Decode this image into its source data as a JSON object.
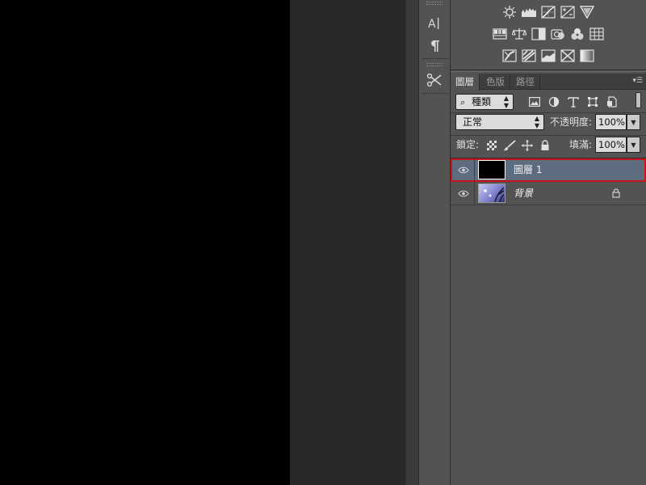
{
  "tool_strip": {
    "tools": [
      {
        "icon": "character-panel-icon",
        "glyph": "A|"
      },
      {
        "icon": "paragraph-panel-icon",
        "glyph": "¶"
      },
      {
        "icon": "tool-presets-icon",
        "glyph": "✂"
      }
    ]
  },
  "adjustments": {
    "row1": [
      "brightness-contrast-icon",
      "levels-icon",
      "curves-icon",
      "exposure-icon",
      "vibrance-icon"
    ],
    "row2": [
      "hue-saturation-icon",
      "color-balance-icon",
      "black-white-icon",
      "photo-filter-icon",
      "channel-mixer-icon",
      "color-lookup-icon"
    ],
    "row3": [
      "invert-icon",
      "posterize-icon",
      "threshold-icon",
      "selective-color-icon",
      "gradient-map-icon"
    ]
  },
  "layers_panel": {
    "tabs": [
      {
        "label": "圖層",
        "active": true
      },
      {
        "label": "色版",
        "active": false
      },
      {
        "label": "路徑",
        "active": false
      }
    ],
    "menu_glyph": "▾☰",
    "filter": {
      "search_glyph": "⌕",
      "kind_label": "種類",
      "filter_icons": [
        "image-filter-icon",
        "adjustment-filter-icon",
        "type-filter-icon",
        "shape-filter-icon",
        "smart-object-filter-icon"
      ]
    },
    "blend": {
      "mode": "正常",
      "opacity_label": "不透明度:",
      "opacity_value": "100%"
    },
    "lock": {
      "label": "鎖定:",
      "fill_label": "填滿:",
      "fill_value": "100%"
    },
    "layers": [
      {
        "name": "圖層 1",
        "selected": true,
        "italic": false,
        "locked": false,
        "thumb_color": "#000000"
      },
      {
        "name": "背景",
        "selected": false,
        "italic": true,
        "locked": true,
        "thumb_color": "#8d8fd6"
      }
    ]
  },
  "colors": {
    "panel_bg": "#535353",
    "selected_layer": "#5e6c80",
    "highlight_outline": "#c8141c",
    "canvas": "#000000",
    "pasteboard": "#282828"
  }
}
